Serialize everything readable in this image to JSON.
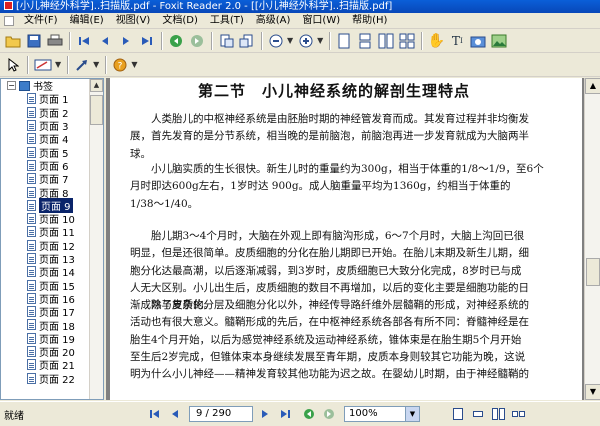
{
  "window": {
    "title": "[小儿神经外科学]..扫描版.pdf - Foxit Reader 2.0 - [[小儿神经外科学]..扫描版.pdf]"
  },
  "menu": [
    {
      "label": "文件(F)"
    },
    {
      "label": "编辑(E)"
    },
    {
      "label": "视图(V)"
    },
    {
      "label": "文档(D)"
    },
    {
      "label": "工具(T)"
    },
    {
      "label": "高级(A)"
    },
    {
      "label": "窗口(W)"
    },
    {
      "label": "帮助(H)"
    }
  ],
  "bookmarks": {
    "root_label": "书签",
    "items": [
      {
        "label": "页面 1"
      },
      {
        "label": "页面 2"
      },
      {
        "label": "页面 3"
      },
      {
        "label": "页面 4"
      },
      {
        "label": "页面 5"
      },
      {
        "label": "页面 6"
      },
      {
        "label": "页面 7"
      },
      {
        "label": "页面 8"
      },
      {
        "label": "页面 9"
      },
      {
        "label": "页面 10"
      },
      {
        "label": "页面 11"
      },
      {
        "label": "页面 12"
      },
      {
        "label": "页面 13"
      },
      {
        "label": "页面 14"
      },
      {
        "label": "页面 15"
      },
      {
        "label": "页面 16"
      },
      {
        "label": "页面 17"
      },
      {
        "label": "页面 18"
      },
      {
        "label": "页面 19"
      },
      {
        "label": "页面 20"
      },
      {
        "label": "页面 21"
      },
      {
        "label": "页面 22"
      }
    ],
    "selected_label": "页面 9"
  },
  "document": {
    "heading": "第二节　小儿神经系统的解剖生理特点",
    "p1": [
      "人类胎儿的中枢神经系统是由胚胎时期的神经管发育而成。其发育过程并非均衡发",
      "展，首先发育的是分节系统，相当晚的是前脑泡，前脑泡再进一步发育就成为大脑两半",
      "球。"
    ],
    "p2": [
      "小儿脑实质的生长很快。新生儿时的重量约为300g，相当于体重的1/8～1/9，至6个",
      "月时即达600g左右，1岁时达 900g。成人脑重量平均为1360g，约相当于体重的",
      "1/38～1/40。"
    ],
    "p3": [
      "胎儿期3～4个月时，大脑在外观上即有脑沟形成，6～7个月时，大脑上沟回已很",
      "明显，但是还很简单。皮质细胞的分化在胎儿期即已开始。在胎儿末期及新生儿期，细",
      "胞分化达最高潮，以后逐渐减弱，到3岁时，皮质细胞已大致分化完成，8岁时已与成",
      "人无大区别。小儿出生后，皮质细胞的数目不再增加，以后的变化主要是细胞功能的日",
      "渐成熟与复杂化。"
    ],
    "p4": [
      "除了皮质的分层及细胞分化以外，神经传导路纤维外层髓鞘的形成，对神经系统的",
      "活动也有很大意义。髓鞘形成的先后，在中枢神经系统各部各有所不同：脊髓神经是在",
      "胎生4个月开始，以后为感觉神经系统及运动神经系统，锥体束是在胎生期5个月开始",
      "至生后2岁完成，但锥体束本身继续发展至青年期，皮质本身则较其它功能为晚，这说",
      "明为什么小儿神经——精神发育较其他功能为迟之故。在婴幼儿时期，由于神经髓鞘的"
    ]
  },
  "statusbar": {
    "status": "就绪",
    "page_field": "9 / 290",
    "zoom": "100%"
  }
}
